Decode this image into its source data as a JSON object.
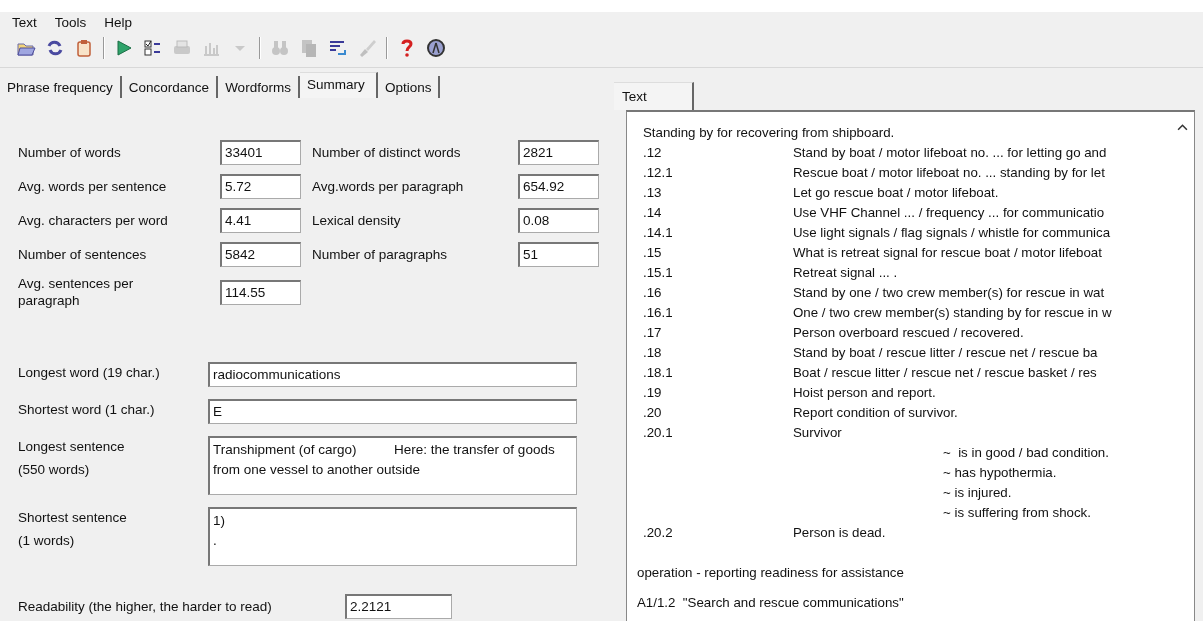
{
  "menu": [
    {
      "label": "Text"
    },
    {
      "label": "Tools"
    },
    {
      "label": "Help"
    }
  ],
  "toolbar": [
    {
      "kind": "open",
      "disabled": false
    },
    {
      "kind": "refresh",
      "disabled": false
    },
    {
      "kind": "clipboard",
      "disabled": false
    },
    {
      "kind": "sep"
    },
    {
      "kind": "play",
      "disabled": false
    },
    {
      "kind": "checklist",
      "disabled": false
    },
    {
      "kind": "printer",
      "disabled": true
    },
    {
      "kind": "chart",
      "disabled": true
    },
    {
      "kind": "caret",
      "disabled": true
    },
    {
      "kind": "sep"
    },
    {
      "kind": "binoculars",
      "disabled": true
    },
    {
      "kind": "copy",
      "disabled": true
    },
    {
      "kind": "wrap",
      "disabled": false
    },
    {
      "kind": "brush",
      "disabled": true
    },
    {
      "kind": "sep"
    },
    {
      "kind": "help",
      "disabled": false
    },
    {
      "kind": "about",
      "disabled": false
    }
  ],
  "left_tabs": [
    {
      "label": "Phrase frequency",
      "selected": false
    },
    {
      "label": "Concordance",
      "selected": false
    },
    {
      "label": "Wordforms",
      "selected": false
    },
    {
      "label": "Summary",
      "selected": true
    },
    {
      "label": "Options",
      "selected": false
    }
  ],
  "stats": [
    {
      "label": "Number of words",
      "value": "33401"
    },
    {
      "label": "Number of distinct words",
      "value": "2821"
    },
    {
      "label": "Avg. words per sentence",
      "value": "5.72"
    },
    {
      "label": "Avg.words per paragraph",
      "value": "654.92"
    },
    {
      "label": "Avg. characters per word",
      "value": "4.41"
    },
    {
      "label": "Lexical density",
      "value": "0.08"
    },
    {
      "label": "Number of sentences",
      "value": "5842"
    },
    {
      "label": "Number of paragraphs",
      "value": "51"
    },
    {
      "label": "Avg. sentences per paragraph",
      "value": "114.55"
    }
  ],
  "longest_word": {
    "label": "Longest word  (19 char.)",
    "value": "radiocommunications"
  },
  "shortest_word": {
    "label": "Shortest word  (1 char.)",
    "value": "E"
  },
  "longest_sentence": {
    "label": "Longest sentence",
    "count": "(550 words)",
    "value": "Transhipment (of cargo)          Here: the transfer of goods from one vessel to another outside"
  },
  "shortest_sentence": {
    "label": "Shortest sentence",
    "count": "(1 words)",
    "value": "1)\n."
  },
  "readability": {
    "label": "Readability (the higher, the harder to read)",
    "value": "2.2121"
  },
  "right_tabs": [
    {
      "label": "Text",
      "selected": true
    }
  ],
  "text_lines": [
    {
      "kind": "plain",
      "text": "Standing by for recovering from shipboard."
    },
    {
      "kind": "item",
      "number": ".12",
      "text": "Stand by boat / motor lifeboat no. ... for letting go and"
    },
    {
      "kind": "item",
      "number": ".12.1",
      "text": "Rescue boat / motor lifeboat no. ... standing by for let"
    },
    {
      "kind": "item",
      "number": ".13",
      "text": "Let go rescue boat / motor lifeboat."
    },
    {
      "kind": "item",
      "number": ".14",
      "text": "Use VHF Channel ... / frequency ... for communicatio"
    },
    {
      "kind": "item",
      "number": ".14.1",
      "text": "Use light signals / flag signals / whistle for communica"
    },
    {
      "kind": "item",
      "number": ".15",
      "text": "What is retreat signal for rescue boat / motor lifeboat"
    },
    {
      "kind": "item",
      "number": ".15.1",
      "text": "Retreat signal ... ."
    },
    {
      "kind": "item",
      "number": ".16",
      "text": "Stand by one / two crew member(s) for rescue in wat"
    },
    {
      "kind": "item",
      "number": ".16.1",
      "text": "One / two crew member(s) standing by for rescue in w"
    },
    {
      "kind": "item",
      "number": ".17",
      "text": "Person overboard rescued / recovered."
    },
    {
      "kind": "item",
      "number": ".18",
      "text": "Stand by boat / rescue litter / rescue net / rescue ba"
    },
    {
      "kind": "item",
      "number": ".18.1",
      "text": "Boat / rescue litter / rescue net / rescue basket / res"
    },
    {
      "kind": "item",
      "number": ".19",
      "text": "Hoist person and report."
    },
    {
      "kind": "item",
      "number": ".20",
      "text": "Report condition of survivor."
    },
    {
      "kind": "item",
      "number": ".20.1",
      "text": "Survivor"
    },
    {
      "kind": "sub",
      "text": "~  is in good / bad condition."
    },
    {
      "kind": "sub",
      "text": "~ has hypothermia."
    },
    {
      "kind": "sub",
      "text": "~ is injured."
    },
    {
      "kind": "sub",
      "text": "~ is suffering from shock."
    },
    {
      "kind": "item",
      "number": ".20.2",
      "text": "Person is dead."
    },
    {
      "kind": "para",
      "text": "operation - reporting readiness for assistance"
    },
    {
      "kind": "section",
      "text": "A1/1.2  \"Search and rescue communications\""
    }
  ]
}
